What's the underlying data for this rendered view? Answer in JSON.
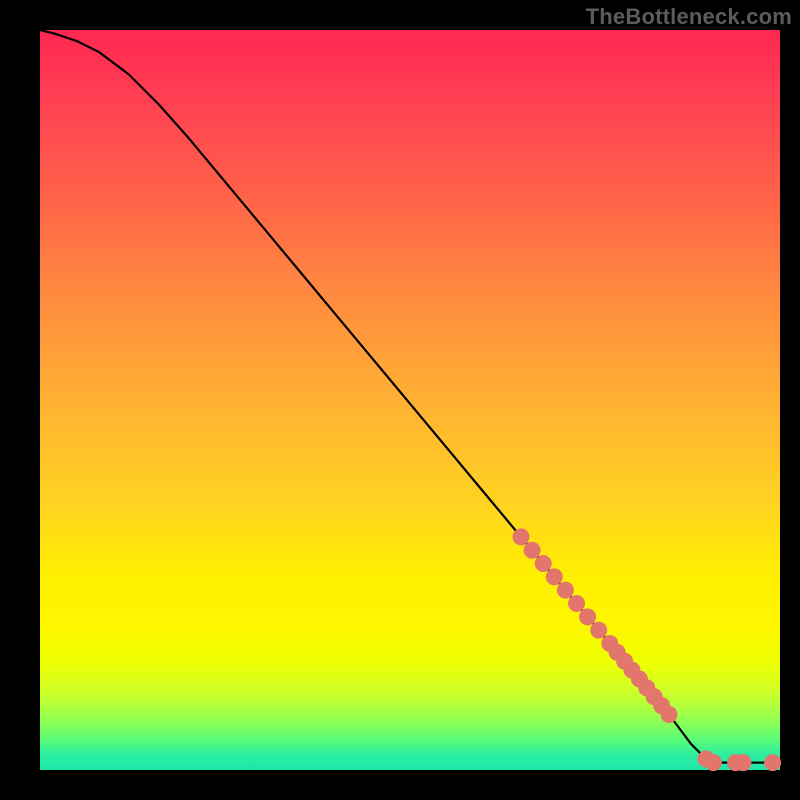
{
  "watermark_text": "TheBottleneck.com",
  "colors": {
    "dot_fill": "#e2766c",
    "curve_stroke": "#000000",
    "frame_bg": "#000000",
    "gradient_top": "#ff2751",
    "gradient_bottom": "#1ee7aa"
  },
  "chart_data": {
    "type": "line",
    "title": "",
    "xlabel": "",
    "ylabel": "",
    "xlim": [
      0,
      100
    ],
    "ylim": [
      0,
      100
    ],
    "grid": false,
    "legend": false,
    "curve": [
      {
        "x": 0,
        "y": 100
      },
      {
        "x": 2,
        "y": 99.5
      },
      {
        "x": 5,
        "y": 98.5
      },
      {
        "x": 8,
        "y": 97
      },
      {
        "x": 12,
        "y": 94
      },
      {
        "x": 16,
        "y": 90
      },
      {
        "x": 20,
        "y": 85.5
      },
      {
        "x": 25,
        "y": 79.5
      },
      {
        "x": 30,
        "y": 73.5
      },
      {
        "x": 35,
        "y": 67.5
      },
      {
        "x": 40,
        "y": 61.5
      },
      {
        "x": 45,
        "y": 55.5
      },
      {
        "x": 50,
        "y": 49.5
      },
      {
        "x": 55,
        "y": 43.5
      },
      {
        "x": 60,
        "y": 37.5
      },
      {
        "x": 65,
        "y": 31.5
      },
      {
        "x": 70,
        "y": 25.5
      },
      {
        "x": 75,
        "y": 19.5
      },
      {
        "x": 80,
        "y": 13.5
      },
      {
        "x": 85,
        "y": 7.5
      },
      {
        "x": 88,
        "y": 3.5
      },
      {
        "x": 90,
        "y": 1.5
      },
      {
        "x": 91,
        "y": 1.0
      },
      {
        "x": 92,
        "y": 1.0
      },
      {
        "x": 94,
        "y": 1.0
      },
      {
        "x": 96,
        "y": 1.0
      },
      {
        "x": 98,
        "y": 1.0
      },
      {
        "x": 100,
        "y": 1.0
      }
    ],
    "scatter_points": [
      {
        "x": 65,
        "y": 31.5
      },
      {
        "x": 66.5,
        "y": 29.7
      },
      {
        "x": 68,
        "y": 27.9
      },
      {
        "x": 69.5,
        "y": 26.1
      },
      {
        "x": 71,
        "y": 24.3
      },
      {
        "x": 72.5,
        "y": 22.5
      },
      {
        "x": 74,
        "y": 20.7
      },
      {
        "x": 75.5,
        "y": 18.9
      },
      {
        "x": 77,
        "y": 17.1
      },
      {
        "x": 78,
        "y": 15.9
      },
      {
        "x": 79,
        "y": 14.7
      },
      {
        "x": 80,
        "y": 13.5
      },
      {
        "x": 81,
        "y": 12.3
      },
      {
        "x": 82,
        "y": 11.1
      },
      {
        "x": 83,
        "y": 9.9
      },
      {
        "x": 84,
        "y": 8.7
      },
      {
        "x": 85,
        "y": 7.5
      },
      {
        "x": 90,
        "y": 1.5
      },
      {
        "x": 91,
        "y": 1.0
      },
      {
        "x": 94,
        "y": 1.0
      },
      {
        "x": 95,
        "y": 1.0
      },
      {
        "x": 99,
        "y": 1.0
      }
    ]
  }
}
